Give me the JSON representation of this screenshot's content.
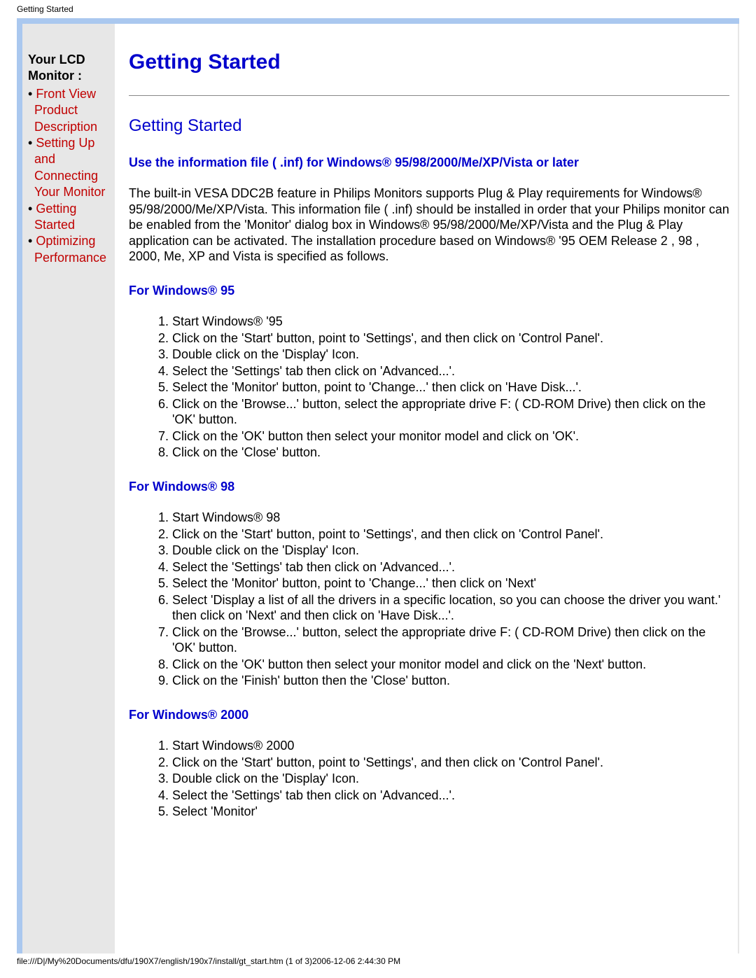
{
  "header": {
    "title": "Getting Started"
  },
  "sidebar": {
    "title": "Your LCD Monitor :",
    "items": [
      {
        "label": "Front View Product Description",
        "link": true
      },
      {
        "label": "Setting Up and Connecting Your Monitor",
        "link": true
      },
      {
        "label": "Getting Started",
        "link": true
      },
      {
        "label": "Optimizing Performance",
        "link": true
      }
    ]
  },
  "main": {
    "page_title": "Getting Started",
    "section_heading": "Getting Started",
    "sub_heading": "Use the information file ( .inf) for Windows® 95/98/2000/Me/XP/Vista or later",
    "intro": "The built-in VESA DDC2B feature in Philips Monitors supports Plug & Play requirements for Windows® 95/98/2000/Me/XP/Vista. This information file ( .inf) should be installed in order that your Philips monitor can be enabled from the 'Monitor' dialog box in Windows® 95/98/2000/Me/XP/Vista and the Plug & Play application can be activated. The installation procedure based on Windows® '95 OEM Release 2 , 98 , 2000, Me, XP and Vista is specified as follows.",
    "sections": [
      {
        "heading": "For Windows® 95",
        "steps": [
          "Start Windows® '95",
          "Click on the 'Start' button, point to 'Settings', and then click on 'Control Panel'.",
          "Double click on the 'Display' Icon.",
          "Select the 'Settings' tab then click on 'Advanced...'.",
          "Select the 'Monitor' button, point to 'Change...' then click on 'Have Disk...'.",
          "Click on the 'Browse...' button, select the appropriate drive F: ( CD-ROM Drive) then click on the 'OK' button.",
          "Click on the 'OK' button then select your monitor model and click on 'OK'.",
          "Click on the 'Close' button."
        ]
      },
      {
        "heading": "For Windows® 98",
        "steps": [
          "Start Windows® 98",
          "Click on the 'Start' button, point to 'Settings', and then click on 'Control Panel'.",
          "Double click on the 'Display' Icon.",
          "Select the 'Settings' tab then click on 'Advanced...'.",
          "Select the 'Monitor' button, point to 'Change...' then click on 'Next'",
          "Select 'Display a list of all the drivers in a specific location, so you can choose the driver you want.' then click on 'Next' and then click on 'Have Disk...'.",
          "Click on the 'Browse...' button, select the appropriate drive F: ( CD-ROM Drive) then click on the 'OK' button.",
          "Click on the 'OK' button then select your monitor model and click on the 'Next' button.",
          "Click on the 'Finish' button then the 'Close' button."
        ]
      },
      {
        "heading": "For Windows® 2000",
        "steps": [
          "Start Windows® 2000",
          "Click on the 'Start' button, point to 'Settings', and then click on 'Control Panel'.",
          "Double click on the 'Display' Icon.",
          "Select the 'Settings' tab then click on 'Advanced...'.",
          "Select 'Monitor'"
        ]
      }
    ]
  },
  "footer": {
    "path": "file:///D|/My%20Documents/dfu/190X7/english/190x7/install/gt_start.htm (1 of 3)2006-12-06 2:44:30 PM"
  }
}
